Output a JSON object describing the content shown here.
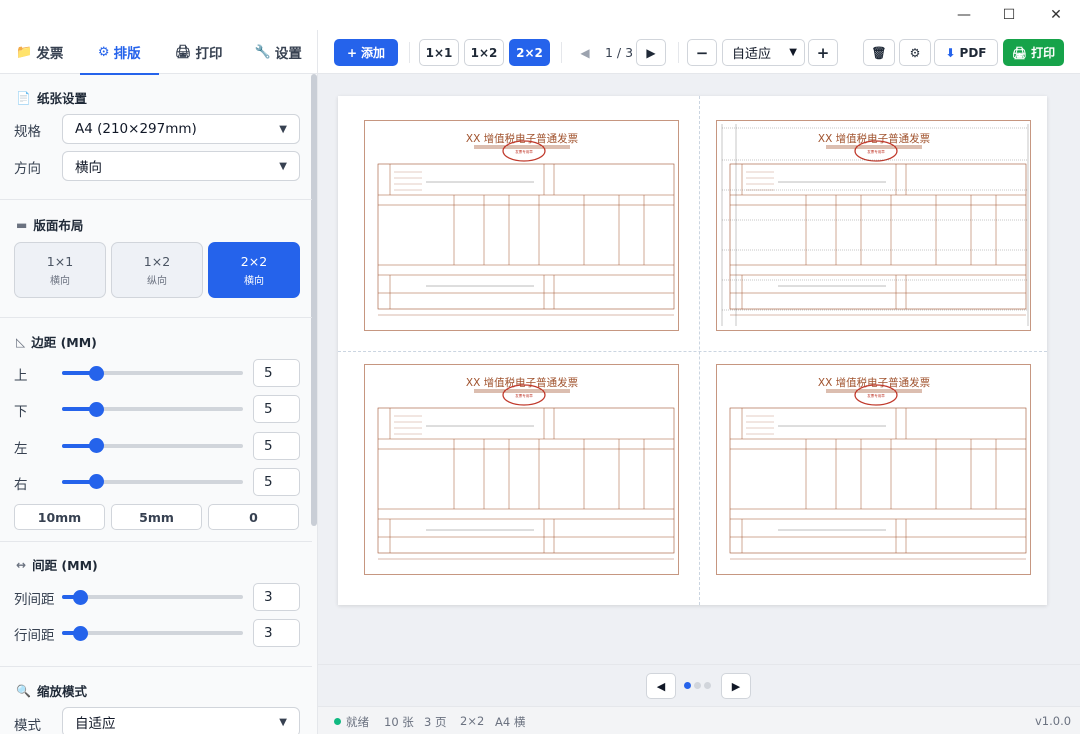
{
  "window": {
    "minimize": "—",
    "maximize": "☐",
    "close": "✕"
  },
  "sidebar": {
    "tabs": [
      {
        "icon": "📁",
        "label": "发票",
        "active": false
      },
      {
        "icon": "⚙",
        "label": "排版",
        "active": true
      },
      {
        "icon": "🖨",
        "label": "打印",
        "active": false
      },
      {
        "icon": "🔧",
        "label": "设置",
        "active": false
      }
    ],
    "paper": {
      "title": "纸张设置",
      "size_label": "规格",
      "size_value": "A4 (210×297mm)",
      "orient_label": "方向",
      "orient_value": "横向"
    },
    "layout": {
      "title": "版面布局",
      "options": [
        {
          "title": "1×1",
          "sub": "横向",
          "active": false
        },
        {
          "title": "1×2",
          "sub": "纵向",
          "active": false
        },
        {
          "title": "2×2",
          "sub": "横向",
          "active": true
        }
      ]
    },
    "margins": {
      "title": "边距 (MM)",
      "rows": [
        {
          "label": "上",
          "value": "5",
          "fraction": 0.19
        },
        {
          "label": "下",
          "value": "5",
          "fraction": 0.19
        },
        {
          "label": "左",
          "value": "5",
          "fraction": 0.19
        },
        {
          "label": "右",
          "value": "5",
          "fraction": 0.19
        }
      ],
      "presets": [
        "10mm",
        "5mm",
        "0"
      ]
    },
    "spacing": {
      "title": "间距 (MM)",
      "rows": [
        {
          "label": "列间距",
          "value": "3",
          "fraction": 0.1
        },
        {
          "label": "行间距",
          "value": "3",
          "fraction": 0.1
        }
      ]
    },
    "zoom": {
      "title": "缩放模式",
      "mode_label": "模式",
      "mode_value": "自适应"
    }
  },
  "toolbar": {
    "add": "添加",
    "layout_buttons": [
      {
        "label": "1×1",
        "active": false
      },
      {
        "label": "1×2",
        "active": false
      },
      {
        "label": "2×2",
        "active": true
      }
    ],
    "page_indicator": "1 / 3",
    "zoom_value": "自适应",
    "pdf": "PDF",
    "print": "打印"
  },
  "invoice": {
    "title": "XX 增值税电子普通发票",
    "stamp": "发票专用章"
  },
  "pager": {
    "dots": 3,
    "active_dot": 0
  },
  "status": {
    "state": "就绪",
    "count": "10 张",
    "pages": "3 页",
    "layout": "2×2",
    "paper": "A4 横",
    "version": "v1.0.0"
  },
  "colors": {
    "accent": "#2563eb",
    "green": "#16a34a",
    "invoice_line": "#a0522d",
    "stamp": "#c0392b"
  }
}
